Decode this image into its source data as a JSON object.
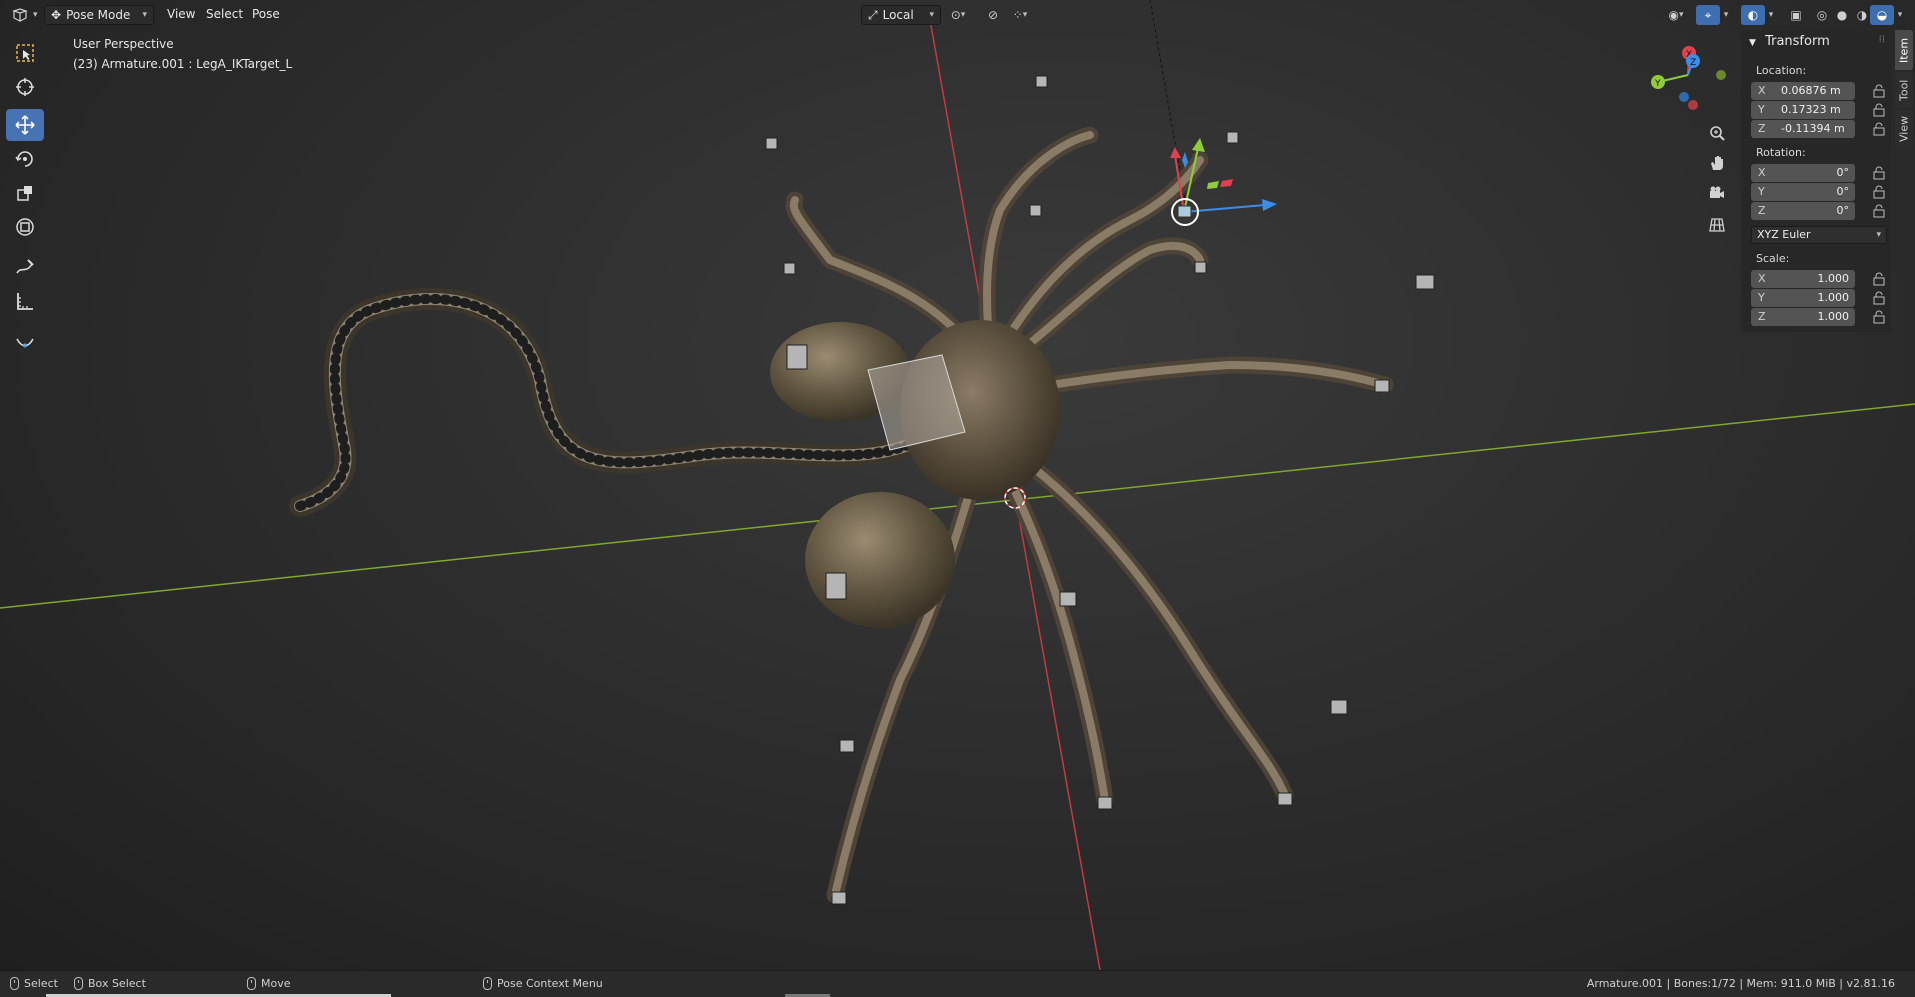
{
  "header": {
    "mode_label": "Pose Mode",
    "menus": [
      "View",
      "Select",
      "Pose"
    ],
    "orientation_label": "Local"
  },
  "viewport": {
    "perspective_label": "User Perspective",
    "object_label": "(23) Armature.001 : LegA_IKTarget_L"
  },
  "gizmo": {
    "x": "X",
    "y": "Y",
    "z": "Z"
  },
  "panel": {
    "title": "Transform",
    "location_label": "Location:",
    "location": [
      {
        "axis": "X",
        "value": "0.06876 m"
      },
      {
        "axis": "Y",
        "value": "0.17323 m"
      },
      {
        "axis": "Z",
        "value": "-0.11394 m"
      }
    ],
    "rotation_label": "Rotation:",
    "rotation": [
      {
        "axis": "X",
        "value": "0°"
      },
      {
        "axis": "Y",
        "value": "0°"
      },
      {
        "axis": "Z",
        "value": "0°"
      }
    ],
    "rotation_mode": "XYZ Euler",
    "scale_label": "Scale:",
    "scale": [
      {
        "axis": "X",
        "value": "1.000"
      },
      {
        "axis": "Y",
        "value": "1.000"
      },
      {
        "axis": "Z",
        "value": "1.000"
      }
    ]
  },
  "side_tabs": [
    "Item",
    "Tool",
    "View"
  ],
  "status": {
    "select": "Select",
    "box_select": "Box Select",
    "move": "Move",
    "context_menu": "Pose Context Menu",
    "info": "Armature.001 | Bones:1/72 | Mem: 911.0 MiB | v2.81.16"
  },
  "colors": {
    "accent": "#4772b3",
    "axis_x": "#e0414f",
    "axis_y": "#8fcc37",
    "axis_z": "#3b8ee8"
  }
}
